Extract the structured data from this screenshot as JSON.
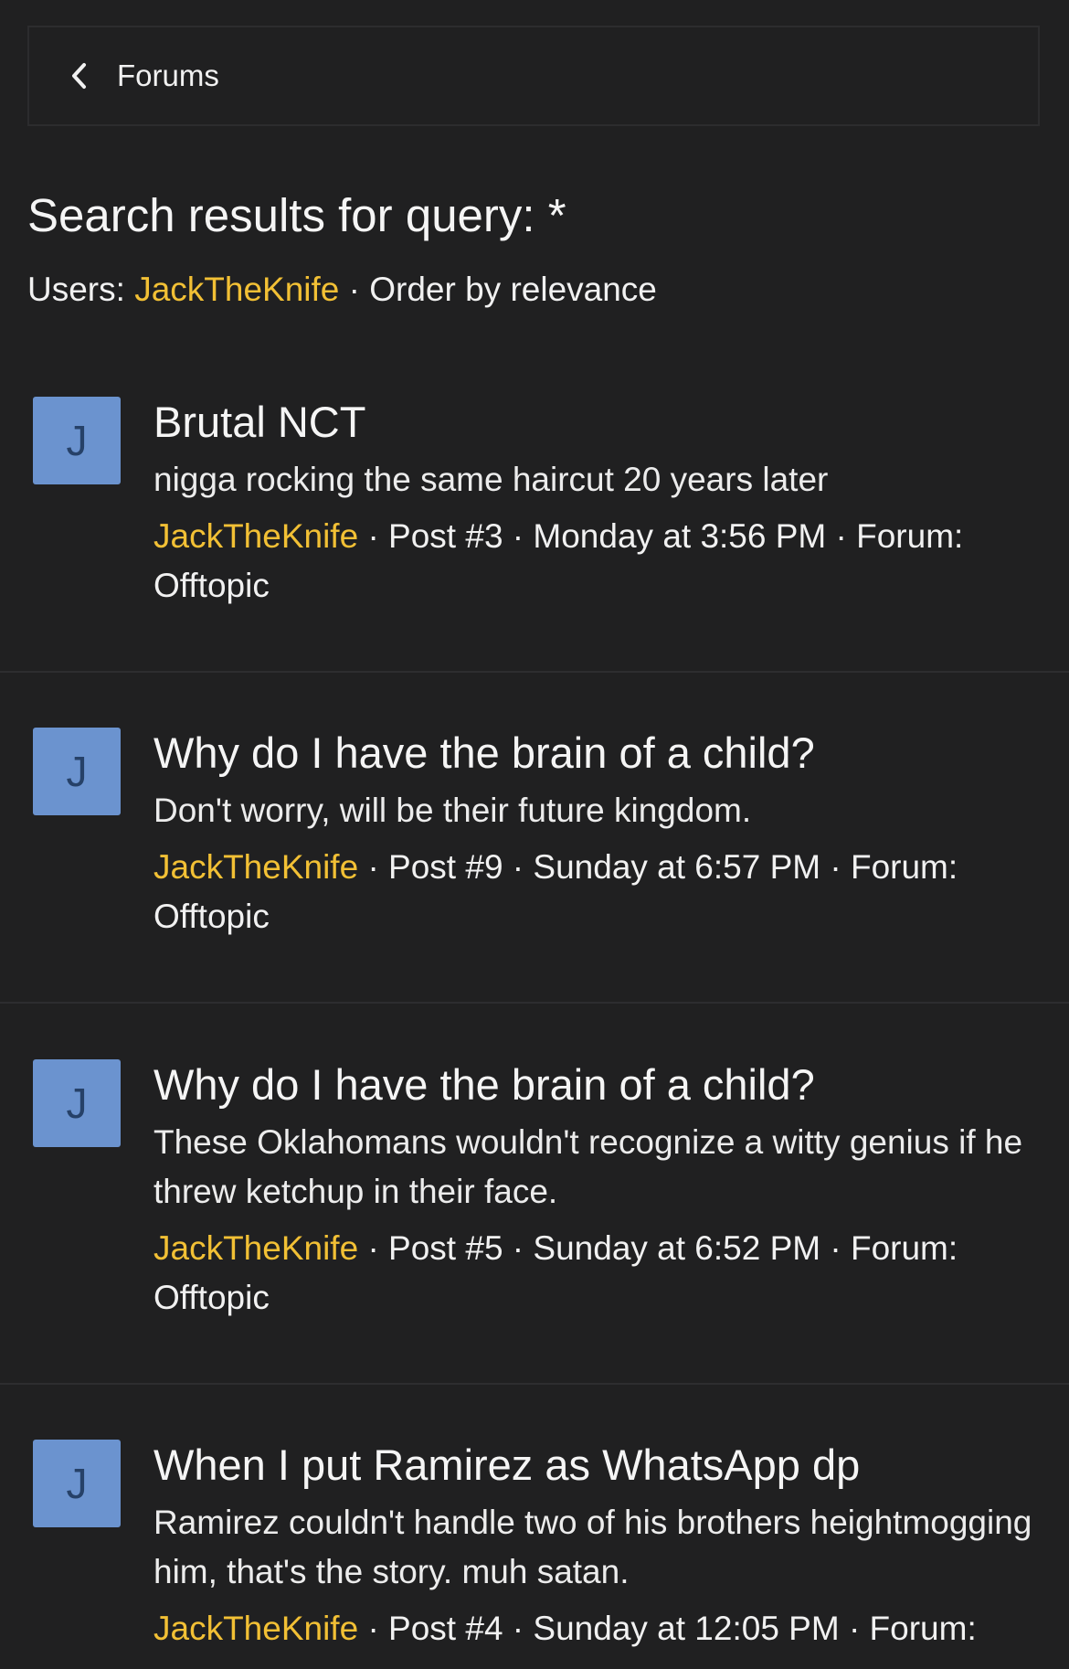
{
  "breadcrumb": {
    "label": "Forums"
  },
  "header": {
    "title": "Search results for query: *",
    "users_label": "Users:",
    "user": "JackTheKnife",
    "order": "· Order by relevance"
  },
  "colors": {
    "background": "#202021",
    "accent": "#f2c035",
    "avatar": "#6b93cf",
    "avatar_letter": "#264168"
  },
  "results": [
    {
      "avatar_letter": "J",
      "title": "Brutal NCT",
      "snippet": "nigga rocking the same haircut 20 years later",
      "author": "JackTheKnife",
      "meta": " · Post #3 · Monday at 3:56 PM · Forum: Offtopic"
    },
    {
      "avatar_letter": "J",
      "title": "Why do I have the brain of a child?",
      "snippet": "Don't worry, will be their future kingdom.",
      "author": "JackTheKnife",
      "meta": " · Post #9 · Sunday at 6:57 PM · Forum: Offtopic"
    },
    {
      "avatar_letter": "J",
      "title": "Why do I have the brain of a child?",
      "snippet": "These Oklahomans wouldn't recognize a witty genius if he threw ketchup in their face.",
      "author": "JackTheKnife",
      "meta": " · Post #5 · Sunday at 6:52 PM · Forum: Offtopic"
    },
    {
      "avatar_letter": "J",
      "title": "When I put Ramirez as WhatsApp dp",
      "snippet": "Ramirez couldn't handle two of his brothers heightmogging him, that's the story. muh satan.",
      "author": "JackTheKnife",
      "meta": " · Post #4 · Sunday at 12:05 PM · Forum:"
    }
  ]
}
